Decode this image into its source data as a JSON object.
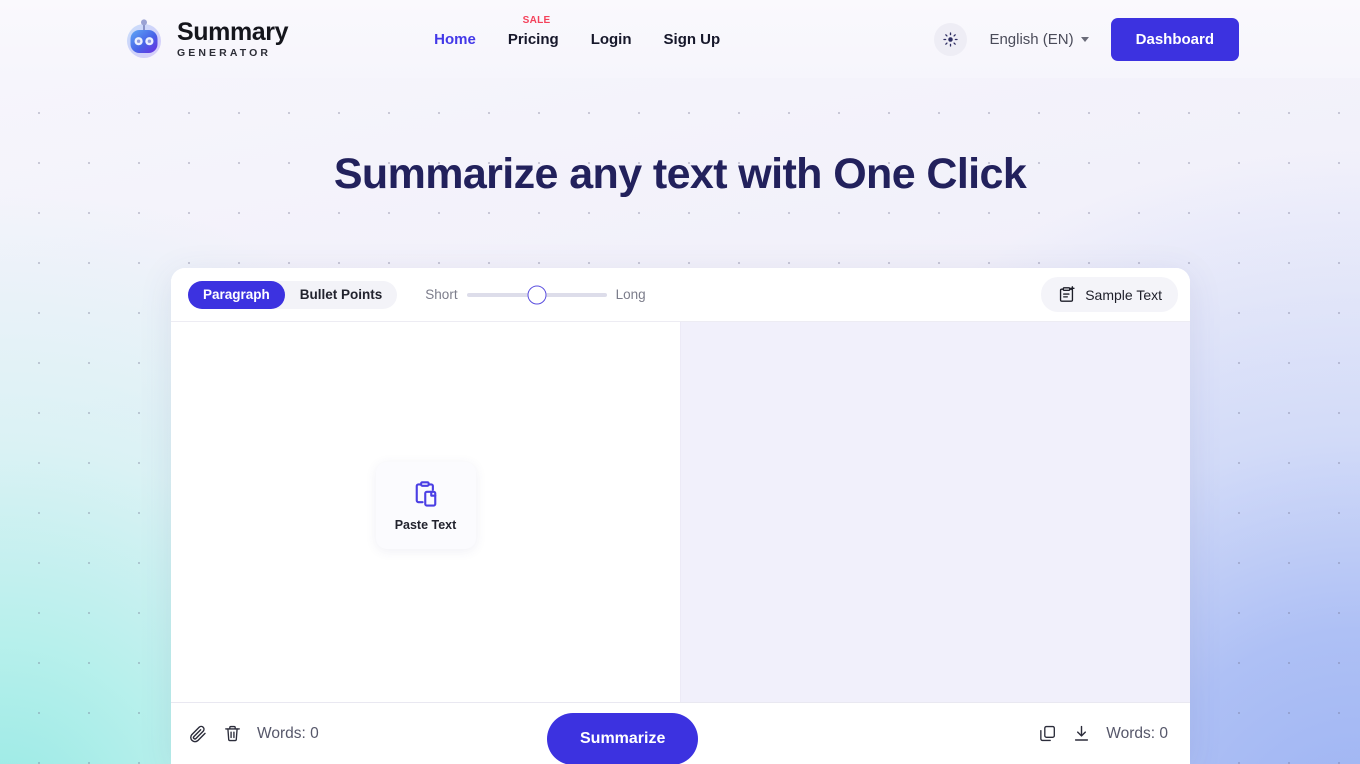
{
  "brand": {
    "title": "Summary",
    "subtitle": "GENERATOR",
    "logo_icon": "robot-icon"
  },
  "nav": {
    "links": [
      {
        "label": "Home",
        "active": true,
        "badge": null
      },
      {
        "label": "Pricing",
        "active": false,
        "badge": "SALE"
      },
      {
        "label": "Login",
        "active": false,
        "badge": null
      },
      {
        "label": "Sign Up",
        "active": false,
        "badge": null
      }
    ],
    "theme_toggle_icon": "sun-icon",
    "language": "English (EN)",
    "language_caret_icon": "chevron-down-icon",
    "dashboard_label": "Dashboard"
  },
  "hero": {
    "title": "Summarize any text with One Click"
  },
  "toolbar": {
    "modes": [
      {
        "label": "Paragraph",
        "active": true
      },
      {
        "label": "Bullet Points",
        "active": false
      }
    ],
    "length_min_label": "Short",
    "length_max_label": "Long",
    "length_value_percent": 50,
    "sample_label": "Sample Text",
    "sample_icon": "clipboard-plus-icon"
  },
  "editor": {
    "paste_label": "Paste Text",
    "paste_icon": "clipboard-paste-icon",
    "input_placeholder": "",
    "input_value": "",
    "output_value": ""
  },
  "footer": {
    "attach_icon": "paperclip-icon",
    "delete_icon": "trash-icon",
    "input_word_count": "Words: 0",
    "summarize_label": "Summarize",
    "copy_icon": "copy-icon",
    "download_icon": "download-icon",
    "output_word_count": "Words: 0"
  },
  "colors": {
    "accent": "#3c32e0",
    "accent_link": "#4338e8",
    "sale_badge": "#f4425b",
    "hero_text": "#22215c",
    "page_bg": "#f3f2fb"
  }
}
